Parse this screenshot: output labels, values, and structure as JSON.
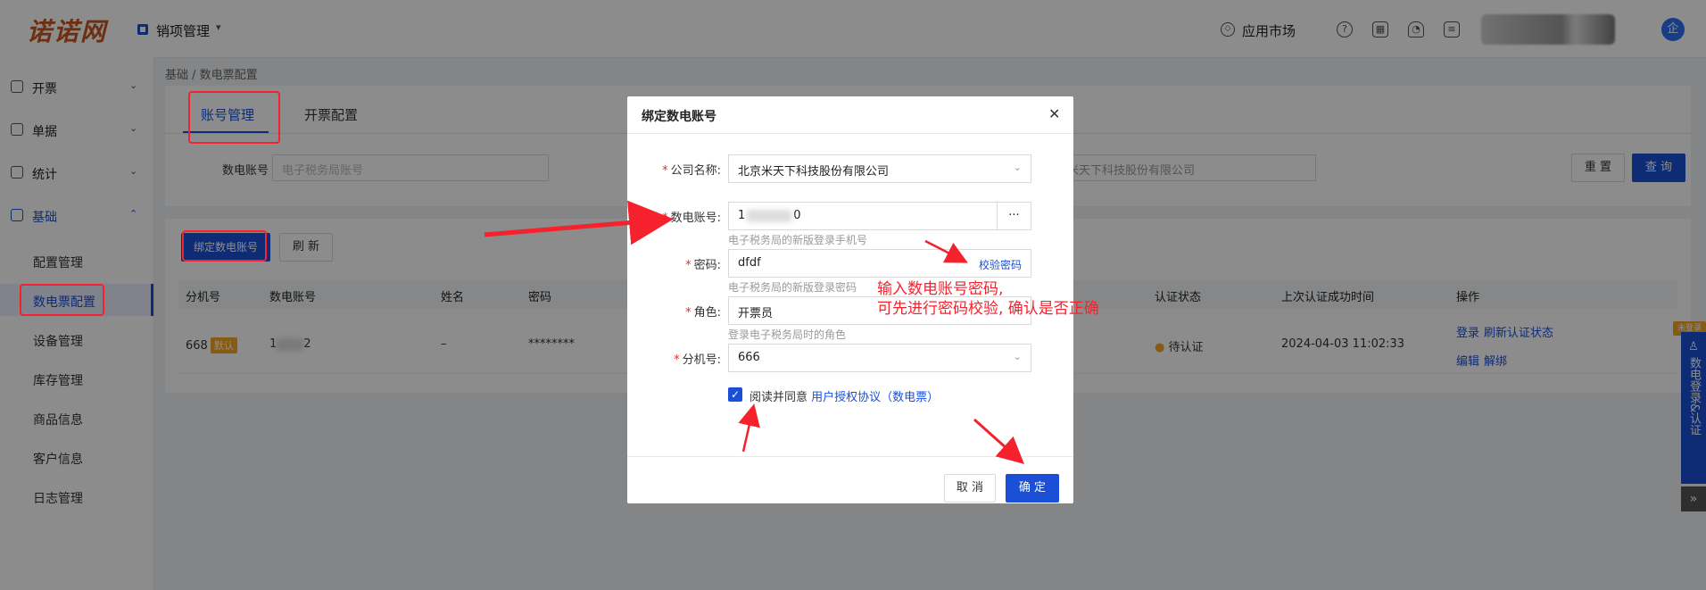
{
  "header": {
    "logo": "诺诺网",
    "module": "销项管理",
    "market": "应用市场",
    "avatar": "企"
  },
  "sidebar": {
    "items": [
      {
        "label": "开票"
      },
      {
        "label": "单据"
      },
      {
        "label": "统计"
      },
      {
        "label": "基础"
      }
    ],
    "subitems": [
      "配置管理",
      "数电票配置",
      "设备管理",
      "库存管理",
      "商品信息",
      "客户信息",
      "日志管理"
    ]
  },
  "breadcrumb": "基础 / 数电票配置",
  "tabs": [
    "账号管理",
    "开票配置"
  ],
  "filter": {
    "account_label": "数电账号",
    "account_placeholder": "电子税务局账号",
    "company_value": "米天下科技股份有限公司",
    "reset": "重 置",
    "query": "查 询"
  },
  "toolbar": {
    "bind": "绑定数电账号",
    "refresh": "刷 新"
  },
  "table": {
    "headers": [
      "分机号",
      "数电账号",
      "姓名",
      "密码",
      "认证状态",
      "上次认证成功时间",
      "操作"
    ],
    "row": {
      "ext": "668",
      "tag": "默认",
      "account_a": "1",
      "account_b": "2",
      "name": "–",
      "password": "********",
      "status": "待认证",
      "last_time": "2024-04-03 11:02:33",
      "ops": [
        "登录",
        "刷新认证状态",
        "编辑",
        "解绑"
      ]
    }
  },
  "modal": {
    "title": "绑定数电账号",
    "close": "✕",
    "company_label": "公司名称:",
    "company_value": "北京米天下科技股份有限公司",
    "account_label": "数电账号:",
    "account_a": "1",
    "account_b": "0",
    "account_more": "···",
    "account_hint": "电子税务局的新版登录手机号",
    "pwd_label": "密码:",
    "pwd_value": "dfdf",
    "pwd_verify": "校验密码",
    "pwd_hint": "电子税务局的新版登录密码",
    "role_label": "角色:",
    "role_value": "开票员",
    "role_hint": "登录电子税务局时的角色",
    "ext_label": "分机号:",
    "ext_value": "666",
    "agree_text": "阅读并同意",
    "agree_link": "用户授权协议（数电票）",
    "cancel": "取 消",
    "ok": "确 定"
  },
  "annotation": {
    "line1": "输入数电账号密码,",
    "line2": "可先进行密码校验, 确认是否正确"
  },
  "side_float": {
    "badge": "未登录",
    "text": "数电登录&认证",
    "more": "»"
  },
  "colors": {
    "primary": "#1a4fd6",
    "annotation": "#f5222d",
    "tag": "#f5a623"
  }
}
